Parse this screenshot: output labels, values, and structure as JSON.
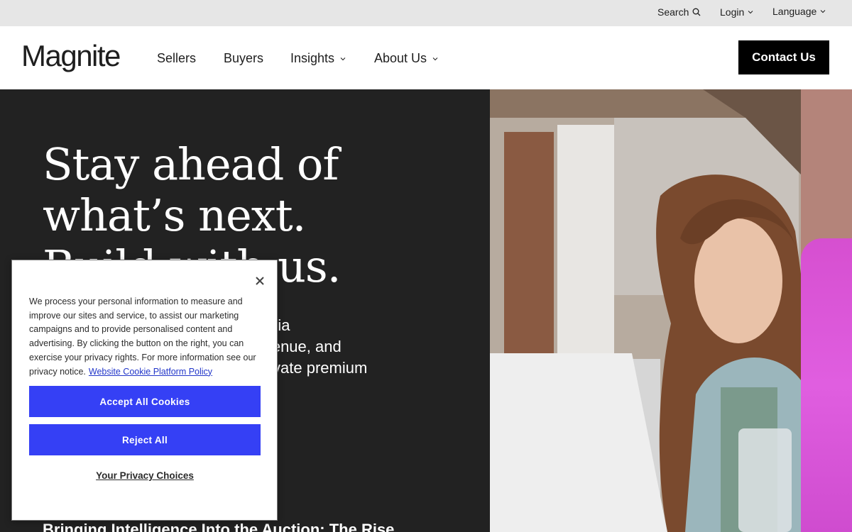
{
  "utility_bar": {
    "search": "Search",
    "login": "Login",
    "language": "Language"
  },
  "nav": {
    "logo": "Magnite",
    "links": [
      "Sellers",
      "Buyers",
      "Insights",
      "About Us"
    ],
    "contact": "Contact Us"
  },
  "hero": {
    "heading_lines": [
      "Stay ahead of",
      "what’s next.",
      "Build with us."
    ],
    "body_lines": [
      "Magnite is the cross-platform media",
      "company that helps you drive revenue, and",
      "helps advertisers access and activate premium"
    ],
    "teaser": "Bringing Intelligence Into the Auction: The Rise"
  },
  "cookie": {
    "text": "We process your personal information to measure and improve our sites and service, to assist our marketing campaigns and to provide personalised content and advertising. By clicking the button on the right, you can exercise your privacy rights. For more information see our privacy notice.",
    "link": "Website Cookie Platform Policy",
    "accept": "Accept All Cookies",
    "reject": "Reject All",
    "choices": "Your Privacy Choices"
  },
  "colors": {
    "accent_blue": "#3540f5",
    "hero_bg": "#222222",
    "pink": "#d64fd0"
  },
  "icons": [
    "search-icon",
    "chevron-down-icon",
    "close-icon"
  ]
}
